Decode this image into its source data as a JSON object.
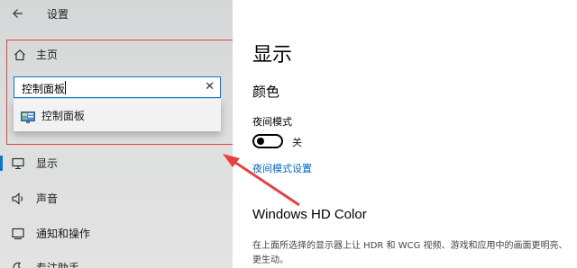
{
  "window": {
    "title": "设置"
  },
  "sidebar": {
    "home_label": "主页",
    "search": {
      "value": "控制面板",
      "placeholder": ""
    },
    "results": [
      {
        "label": "控制面板"
      }
    ],
    "items": [
      {
        "label": "显示",
        "icon": "monitor-icon",
        "active": true
      },
      {
        "label": "声音",
        "icon": "speaker-icon",
        "active": false
      },
      {
        "label": "通知和操作",
        "icon": "notification-icon",
        "active": false
      },
      {
        "label": "专注助手",
        "icon": "moon-icon",
        "active": false
      }
    ]
  },
  "main": {
    "page_title": "显示",
    "section_title": "颜色",
    "night_mode_label": "夜间模式",
    "toggle_state": "关",
    "night_mode_link": "夜间模式设置",
    "hdr_title": "Windows HD Color",
    "hdr_desc": "在上面所选择的显示器上让 HDR 和 WCG 视频、游戏和应用中的画面更明亮、更生动。"
  },
  "colors": {
    "accent": "#0078d7",
    "link": "#0067c0",
    "annotation": "#e34242"
  }
}
